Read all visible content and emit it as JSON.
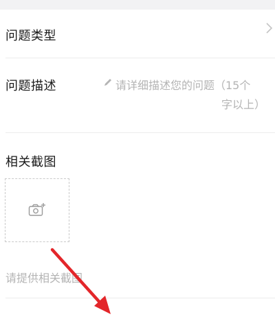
{
  "form": {
    "issue_type_label": "问题类型",
    "issue_desc_label": "问题描述",
    "issue_desc_placeholder_line1": "请详细描述您的问题（15个",
    "issue_desc_placeholder_line2": "字以上）",
    "screenshot_label": "相关截图",
    "screenshot_hint": "请提供相关截图"
  },
  "icons": {
    "issue_type_chevron": "chevron-right-icon",
    "pencil": "pencil-icon",
    "add_photo": "camera-plus-icon",
    "annotation": "red-arrow-annotation"
  },
  "colors": {
    "arrow": "#e3262a",
    "hint_text": "#b4b4b4"
  }
}
